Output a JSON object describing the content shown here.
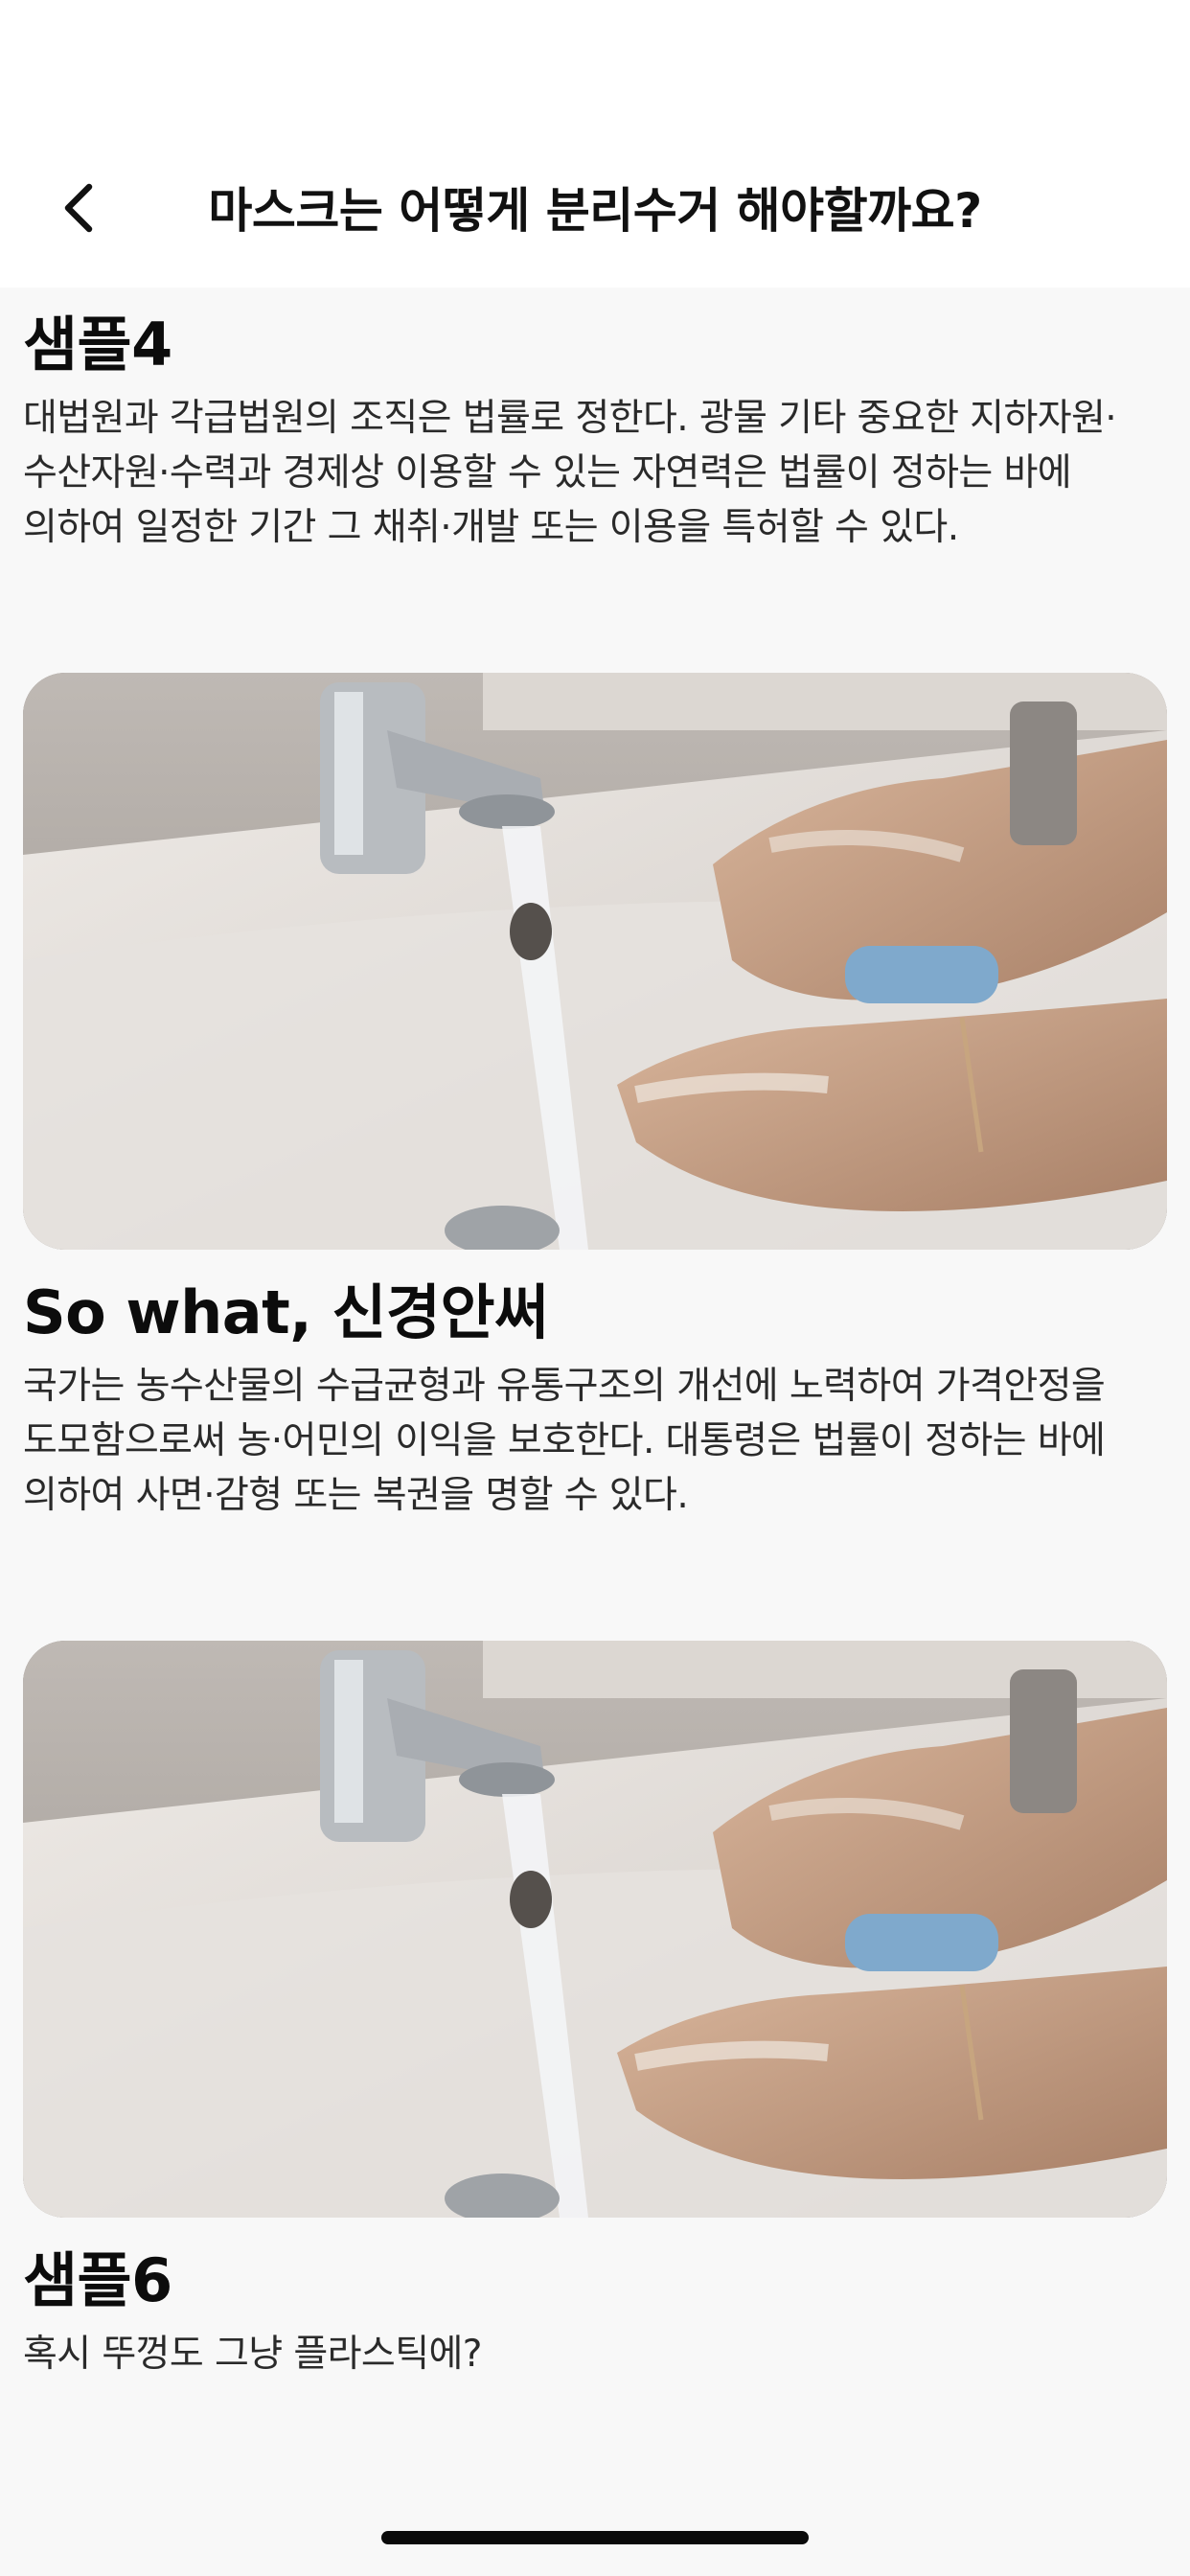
{
  "header": {
    "title": "마스크는 어떻게 분리수거 해야할까요?",
    "back_icon": "chevron-left-icon"
  },
  "sections": [
    {
      "title": "샘플4",
      "body": "대법원과 각급법원의 조직은 법률로 정한다. 광물 기타 중요한 지하자원·수산자원·수력과 경제상 이용할 수 있는 자연력은 법률이 정하는 바에 의하여 일정한 기간 그 채취·개발 또는 이용을 특허할 수 있다."
    },
    {
      "title": "So what, 신경안써",
      "body": "국가는 농수산물의 수급균형과 유통구조의 개선에 노력하여 가격안정을 도모함으로써 농·어민의 이익을 보호한다. 대통령은 법률이 정하는 바에 의하여 사면·감형 또는 복권을 명할 수 있다."
    },
    {
      "title": "샘플6",
      "body": "혹시 뚜껑도 그냥 플라스틱에?"
    }
  ],
  "images": [
    {
      "subject": "washing-hands-photo"
    },
    {
      "subject": "washing-hands-photo"
    }
  ]
}
